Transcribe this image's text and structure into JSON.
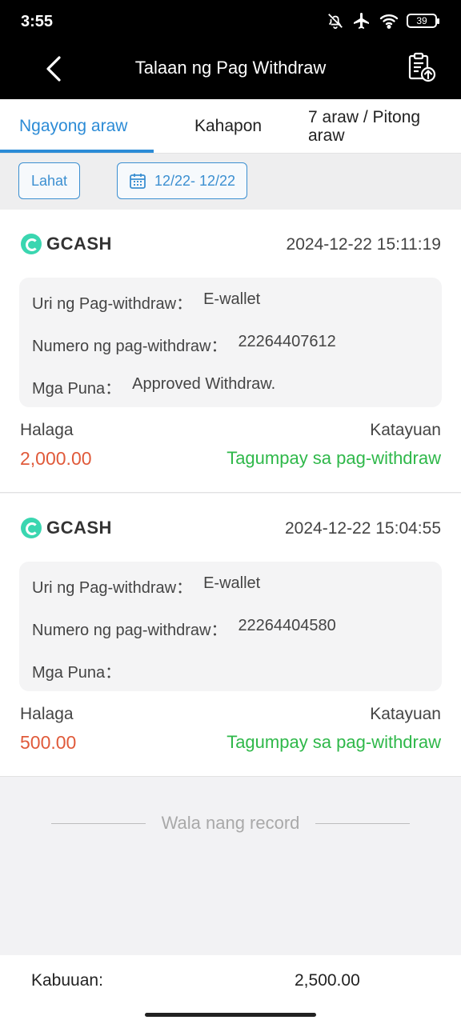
{
  "status_bar": {
    "time": "3:55",
    "battery": "39",
    "icons": [
      "bell-off-icon",
      "airplane-icon",
      "wifi-icon",
      "battery-icon"
    ]
  },
  "header": {
    "title": "Talaan ng Pag Withdraw",
    "back_icon": "back-arrow-icon",
    "action_icon": "clipboard-upload-icon"
  },
  "tabs": [
    {
      "label": "Ngayong araw",
      "active": true
    },
    {
      "label": "Kahapon",
      "active": false
    },
    {
      "label": "7 araw / Pitong araw",
      "active": false
    }
  ],
  "filters": {
    "all_label": "Lahat",
    "date_range": "12/22- 12/22",
    "date_icon": "calendar-icon"
  },
  "records": [
    {
      "provider": "GCASH",
      "time": "2024-12-22 15:11:19",
      "type_label": "Uri ng Pag-withdraw：",
      "type_value": "E-wallet",
      "number_label": "Numero ng pag-withdraw：",
      "number_value": "22264407612",
      "remarks_label": "Mga Puna：",
      "remarks_value": "Approved Withdraw.",
      "amount_label": "Halaga",
      "amount": "2,000.00",
      "status_label": "Katayuan",
      "status": "Tagumpay sa pag-withdraw"
    },
    {
      "provider": "GCASH",
      "time": "2024-12-22 15:04:55",
      "type_label": "Uri ng Pag-withdraw：",
      "type_value": "E-wallet",
      "number_label": "Numero ng pag-withdraw：",
      "number_value": "22264404580",
      "remarks_label": "Mga Puna：",
      "remarks_value": "",
      "amount_label": "Halaga",
      "amount": "500.00",
      "status_label": "Katayuan",
      "status": "Tagumpay sa pag-withdraw"
    }
  ],
  "end_text": "Wala nang record",
  "footer": {
    "total_label": "Kabuuan:",
    "total_value": "2,500.00"
  },
  "colors": {
    "accent": "#2b8bd6",
    "amount": "#e05a3a",
    "success": "#2fb84a",
    "header_bg": "#000000"
  }
}
